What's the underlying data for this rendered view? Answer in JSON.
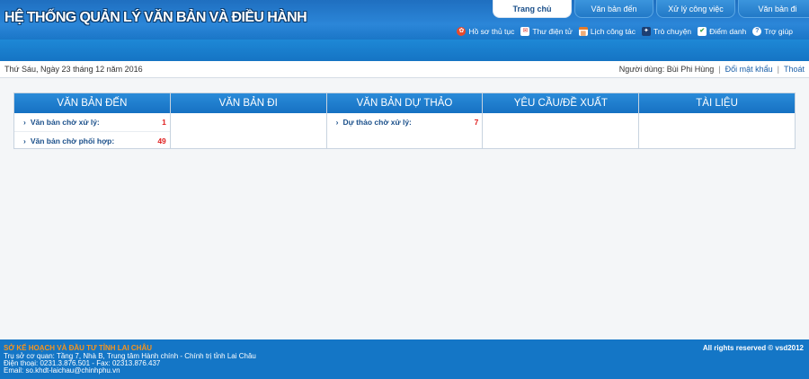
{
  "header": {
    "title": "HỆ THỐNG QUẢN LÝ VĂN BẢN VÀ ĐIỀU HÀNH",
    "tabs": [
      {
        "label": "Trang chủ",
        "active": true
      },
      {
        "label": "Văn bản đến",
        "active": false
      },
      {
        "label": "Xử lý công việc",
        "active": false
      },
      {
        "label": "Văn bản đi",
        "active": false
      }
    ],
    "toolbar": [
      {
        "label": "Hồ sơ thủ tục",
        "icon": "folder-icon",
        "color": "#e84a2c"
      },
      {
        "label": "Thư điện tử",
        "icon": "mail-icon",
        "color": "#d9342b"
      },
      {
        "label": "Lịch công tác",
        "icon": "calendar-icon",
        "color": "#e57b2b"
      },
      {
        "label": "Trò chuyện",
        "icon": "chat-icon",
        "color": "#3a6fb4"
      },
      {
        "label": "Điểm danh",
        "icon": "checkbox-icon",
        "color": "#3aa14a"
      },
      {
        "label": "Trợ giúp",
        "icon": "help-icon",
        "color": "#3d8fe0"
      }
    ]
  },
  "infobar": {
    "date": "Thứ Sáu, Ngày 23 tháng 12 năm 2016",
    "user_label": "Người dùng: Bùi Phi Hùng",
    "change_password": "Đổi mật khẩu",
    "logout": "Thoát",
    "separator": "|"
  },
  "panels": [
    {
      "title": "VĂN BẢN ĐẾN",
      "rows": [
        {
          "label": "Văn bản chờ xử lý:",
          "count": "1"
        },
        {
          "label": "Văn bản chờ phối hợp:",
          "count": "49"
        }
      ]
    },
    {
      "title": "VĂN BẢN ĐI",
      "rows": []
    },
    {
      "title": "VĂN BẢN DỰ THẢO",
      "rows": [
        {
          "label": "Dự thảo chờ xử lý:",
          "count": "7"
        }
      ]
    },
    {
      "title": "YÊU CẦU/ĐỀ XUẤT",
      "rows": []
    },
    {
      "title": "TÀI LIỆU",
      "rows": []
    }
  ],
  "footer": {
    "org": "SỞ KẾ HOẠCH VÀ ĐẦU TƯ TỈNH LAI CHÂU",
    "address": "Trụ sở cơ quan: Tầng 7, Nhà B, Trung tâm Hành chính - Chính trị tỉnh Lai Châu",
    "phone": "Điện thoại: 0231.3.876.501 - Fax: 02313.876.437",
    "email": "Email: so.khdt-laichau@chinhphu.vn",
    "rights": "All rights reserved © vsd2012"
  }
}
